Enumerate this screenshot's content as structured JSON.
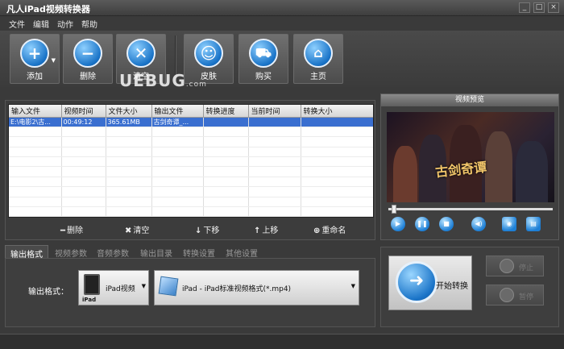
{
  "app": {
    "title": "凡人iPad视频转换器"
  },
  "window_buttons": [
    "_",
    "□",
    "×"
  ],
  "menu": [
    "文件",
    "编辑",
    "动作",
    "帮助"
  ],
  "toolbar": {
    "add": "添加",
    "remove": "删除",
    "clear": "清空",
    "skin": "皮肤",
    "buy": "购买",
    "home": "主页"
  },
  "watermark": {
    "text": "UEBUG",
    "sub": ".com"
  },
  "file_table": {
    "columns": [
      "输入文件",
      "视频时间",
      "文件大小",
      "输出文件",
      "转换进度",
      "当前时间",
      "转换大小"
    ],
    "rows": [
      [
        "E:\\电影2\\古...",
        "00:49:12",
        "365.61MB",
        "古剑奇谭_...",
        "",
        "",
        ""
      ]
    ]
  },
  "list_ops": {
    "delete": "删除",
    "clear": "清空",
    "move_down": "下移",
    "move_up": "上移",
    "rename": "重命名"
  },
  "preview": {
    "title": "视频预览",
    "caption": "古剑奇谭",
    "seek_position": 0.02
  },
  "tabs": [
    "输出格式",
    "视频参数",
    "音频参数",
    "输出目录",
    "转换设置",
    "其他设置"
  ],
  "output": {
    "label": "输出格式：",
    "device_icon_label": "iPad",
    "device": "iPad视频",
    "format": "iPad - iPad标准视频格式(*.mp4)"
  },
  "actions": {
    "start": "开始转换",
    "stop": "停止",
    "pause": "暂停"
  }
}
